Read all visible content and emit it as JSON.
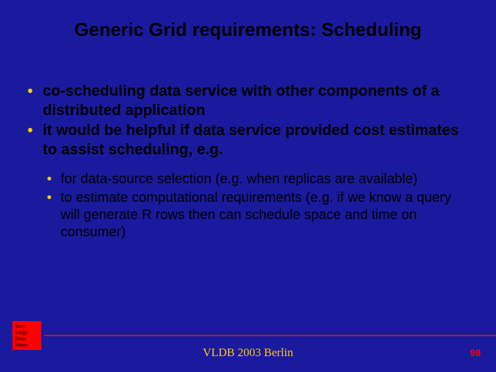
{
  "title": "Generic Grid requirements: Scheduling",
  "bullets": {
    "lvl1": [
      "co-scheduling data service with other components of a distributed application",
      "it would be helpful if data service provided cost estimates to assist scheduling, e.g."
    ],
    "lvl2": [
      "for data-source selection (e.g. when replicas are available)",
      "to estimate computational requirements (e.g. if we know a query will generate R rows then can schedule space and time on consumer)"
    ]
  },
  "badge": {
    "l1": "Very",
    "l2": "Large",
    "l3": "Data",
    "l4": "Bases"
  },
  "footer": "VLDB 2003 Berlin",
  "page": "98"
}
